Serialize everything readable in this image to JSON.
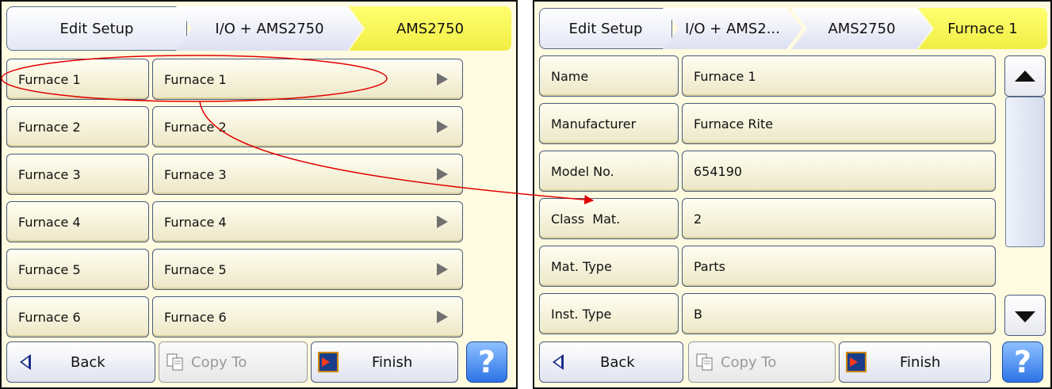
{
  "left": {
    "breadcrumb": [
      "Edit Setup",
      "I/O + AMS2750",
      "AMS2750"
    ],
    "rows": [
      {
        "label": "Furnace 1",
        "value": "Furnace 1"
      },
      {
        "label": "Furnace 2",
        "value": "Furnace 2"
      },
      {
        "label": "Furnace 3",
        "value": "Furnace 3"
      },
      {
        "label": "Furnace 4",
        "value": "Furnace 4"
      },
      {
        "label": "Furnace 5",
        "value": "Furnace 5"
      },
      {
        "label": "Furnace 6",
        "value": "Furnace 6"
      }
    ],
    "buttons": {
      "back": "Back",
      "copy": "Copy To",
      "finish": "Finish",
      "help": "?"
    }
  },
  "right": {
    "breadcrumb": [
      "Edit Setup",
      "I/O + AMS2...",
      "AMS2750",
      "Furnace 1"
    ],
    "rows": [
      {
        "label": "Name",
        "value": "Furnace 1"
      },
      {
        "label": "Manufacturer",
        "value": "Furnace Rite"
      },
      {
        "label": "Model No.",
        "value": "654190"
      },
      {
        "label": "Class  Mat.",
        "value": "2"
      },
      {
        "label": "Mat. Type",
        "value": "Parts"
      },
      {
        "label": "Inst. Type",
        "value": "B"
      }
    ],
    "buttons": {
      "back": "Back",
      "copy": "Copy To",
      "finish": "Finish",
      "help": "?"
    }
  },
  "colors": {
    "accent_yellow": "#f0ee44",
    "panel_bg": "#fffbe0",
    "annotation_red": "#e00000",
    "help_blue": "#2c74e6"
  },
  "icons": [
    "back-arrow-icon",
    "copy-icon",
    "finish-icon",
    "help-icon",
    "row-arrow-icon",
    "scroll-up-icon",
    "scroll-down-icon"
  ]
}
